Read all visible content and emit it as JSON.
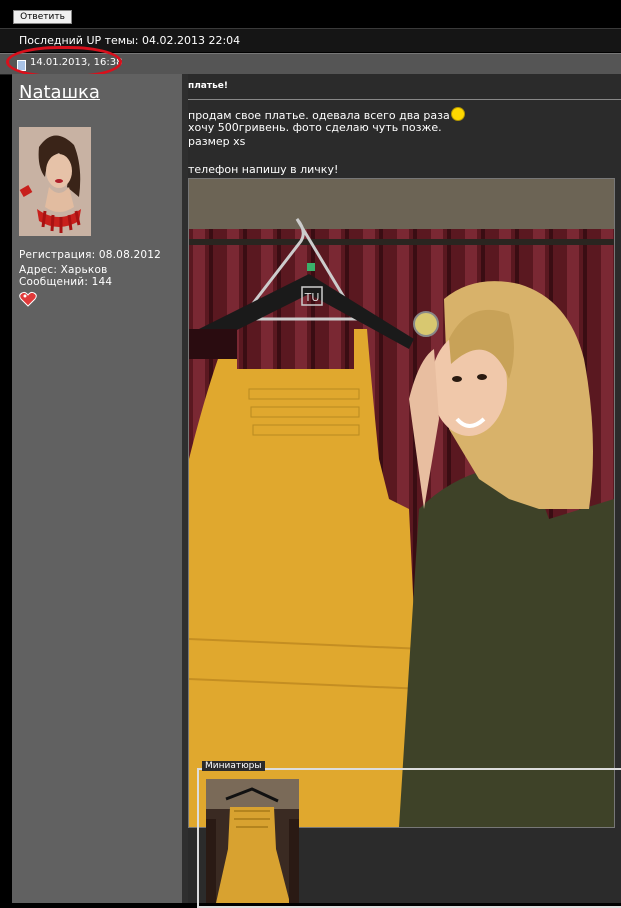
{
  "reply_button": {
    "label": "Ответить"
  },
  "last_up": {
    "text": "Последний UP темы: 04.02.2013 22:04"
  },
  "post": {
    "date": "14.01.2013, 16:38",
    "author": {
      "name": "Nataшка",
      "registration": "Регистрация: 08.08.2012",
      "address": "Адрес: Харьков",
      "messages": "Сообщений: 144"
    },
    "subject": "платье!",
    "body_lines": [
      "продам свое платье. одевала всего два раза",
      "хочу 500гривень. фото сделаю чуть позже.",
      "размер xs",
      "",
      "телефон напишу в личку!"
    ],
    "photo_hanger_text": "TU",
    "thumbnails_label": "Миниатюры"
  },
  "colors": {
    "highlight_ellipse": "#d8101c",
    "sidebar_bg": "#616161",
    "content_bg": "#2b2b2b",
    "dress": "#e0a82e"
  },
  "icons": {
    "smiley": "smiley-icon",
    "date": "document-icon",
    "status": "heart-icon"
  }
}
